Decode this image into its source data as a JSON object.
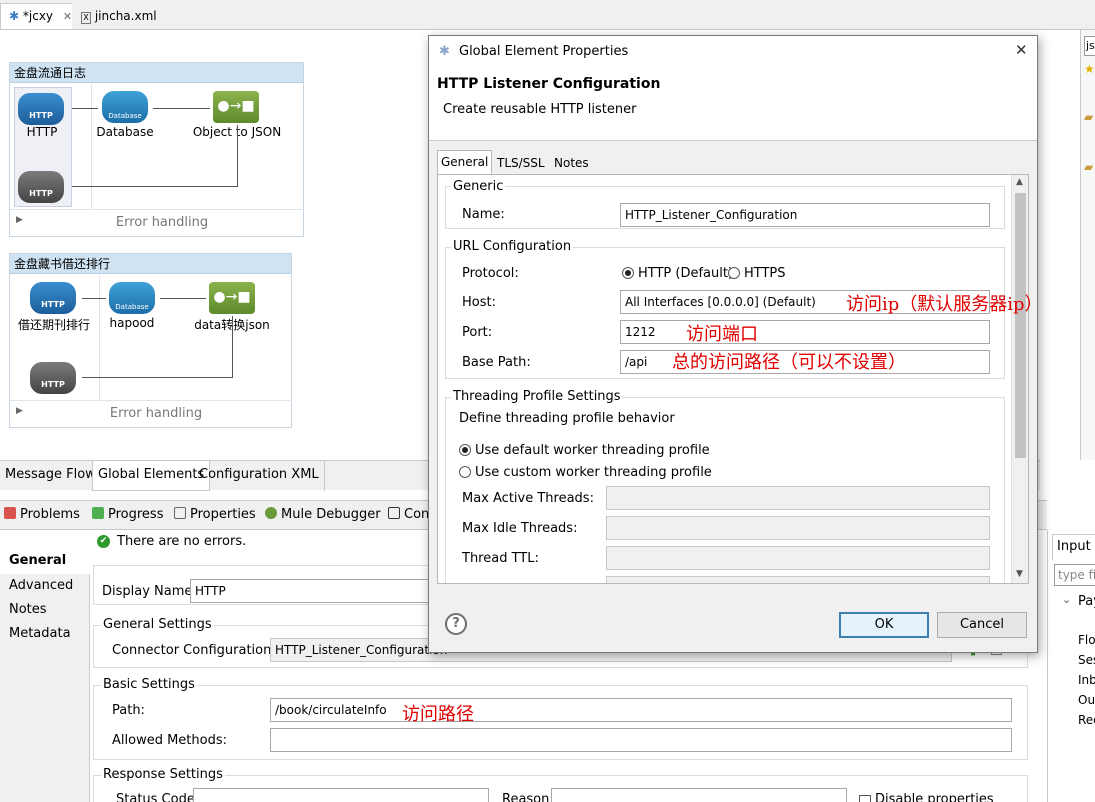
{
  "editor_tabs": [
    {
      "label": "*jcxy",
      "active": true
    },
    {
      "label": "jincha.xml",
      "active": false
    }
  ],
  "flows": [
    {
      "title": "金盘流通日志",
      "nodes": [
        {
          "label": "HTTP",
          "icon": "http-icon"
        },
        {
          "label": "Database",
          "icon": "database-icon"
        },
        {
          "label": "Object to JSON",
          "icon": "object-to-json-icon"
        }
      ],
      "error_handling": "Error handling"
    },
    {
      "title": "金盘藏书借还排行",
      "nodes": [
        {
          "label": "借还期刊排行",
          "icon": "http-icon"
        },
        {
          "label": "hapood",
          "icon": "database-icon"
        },
        {
          "label": "data转换json",
          "icon": "object-to-json-icon"
        }
      ],
      "error_handling": "Error handling"
    }
  ],
  "node_icon_text": {
    "http": "HTTP",
    "database": "Database"
  },
  "bottom_tabs": [
    "Message Flow",
    "Global Elements",
    "Configuration XML"
  ],
  "views": [
    "Problems",
    "Progress",
    "Properties",
    "Mule Debugger",
    "Con"
  ],
  "properties": {
    "nav": [
      "General",
      "Advanced",
      "Notes",
      "Metadata"
    ],
    "status": "There are no errors.",
    "display_name_label": "Display Name:",
    "display_name": "HTTP",
    "general_settings": "General Settings",
    "connector_config_label": "Connector Configuration:",
    "connector_config": "HTTP_Listener_Configuration",
    "basic_settings": "Basic Settings",
    "path_label": "Path:",
    "path": "/book/circulateInfo",
    "allowed_methods_label": "Allowed Methods:",
    "allowed_methods": "",
    "response_settings": "Response Settings",
    "status_code_label": "Status Code:",
    "reason_label": "Reason:",
    "disable_properties": "Disable properties"
  },
  "right_panel": {
    "top_input": "js",
    "tab": "Input",
    "filter_placeholder": "type fil",
    "tree": [
      "Pay",
      "Flo",
      "Ses",
      "Inb",
      "Ou",
      "Rec"
    ]
  },
  "dialog": {
    "window_title": "Global Element Properties",
    "heading": "HTTP Listener Configuration",
    "subtitle": "Create reusable HTTP listener",
    "tabs": [
      "General",
      "TLS/SSL",
      "Notes"
    ],
    "generic_group": "Generic",
    "name_label": "Name:",
    "name_value": "HTTP_Listener_Configuration",
    "url_group": "URL Configuration",
    "protocol_label": "Protocol:",
    "protocol_options": [
      "HTTP (Default)",
      "HTTPS"
    ],
    "host_label": "Host:",
    "host_value": "All Interfaces [0.0.0.0] (Default)",
    "port_label": "Port:",
    "port_value": "1212",
    "base_path_label": "Base Path:",
    "base_path_value": "/api",
    "threading_group": "Threading Profile Settings",
    "threading_desc": "Define threading profile behavior",
    "threading_options": [
      "Use default worker threading profile",
      "Use custom worker threading profile"
    ],
    "max_active_label": "Max Active Threads:",
    "max_idle_label": "Max Idle Threads:",
    "thread_ttl_label": "Thread TTL:",
    "ok": "OK",
    "cancel": "Cancel"
  },
  "annotations": {
    "host": "访问ip（默认服务器ip）",
    "port": "访问端口",
    "base_path": "总的访问路径（可以不设置）",
    "path": "访问路径"
  },
  "colors": {
    "annotation": "#e00000",
    "flow_header": "#cfe3f3",
    "ok_border": "#3c7fb1"
  }
}
